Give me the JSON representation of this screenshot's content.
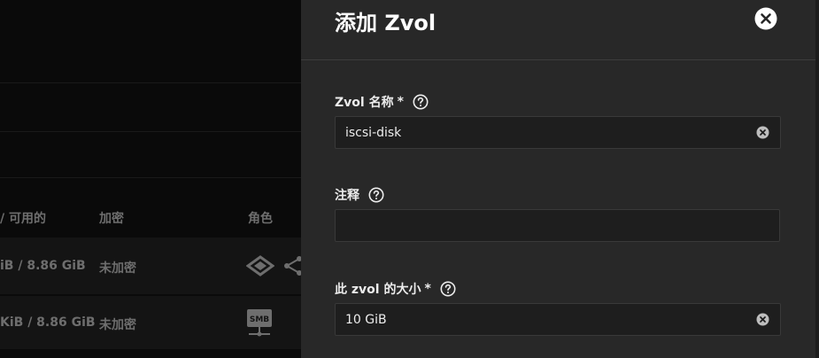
{
  "background": {
    "table_headers": [
      "/ 可用的",
      "加密",
      "角色"
    ],
    "rows": [
      {
        "available": "iB / 8.86 GiB",
        "encryption": "未加密",
        "role_icons": [
          "share-diamond-icon",
          "share-network-icon"
        ]
      },
      {
        "available": "KiB / 8.86 GiB",
        "encryption": "未加密",
        "role_icons": [
          "smb-share-icon"
        ]
      }
    ],
    "smb_text": "SMB"
  },
  "drawer": {
    "title": "添加 Zvol",
    "fields": {
      "name": {
        "label": "Zvol 名称",
        "required_mark": "*",
        "value": "iscsi-disk",
        "placeholder": ""
      },
      "comment": {
        "label": "注释",
        "value": "",
        "placeholder": ""
      },
      "size": {
        "label": "此 zvol 的大小",
        "required_mark": "*",
        "value": "10 GiB",
        "placeholder": ""
      }
    }
  },
  "colors": {
    "drawer_bg": "#282828",
    "field_bg": "#1e1e1e",
    "page_bg": "#0a0a0a"
  }
}
